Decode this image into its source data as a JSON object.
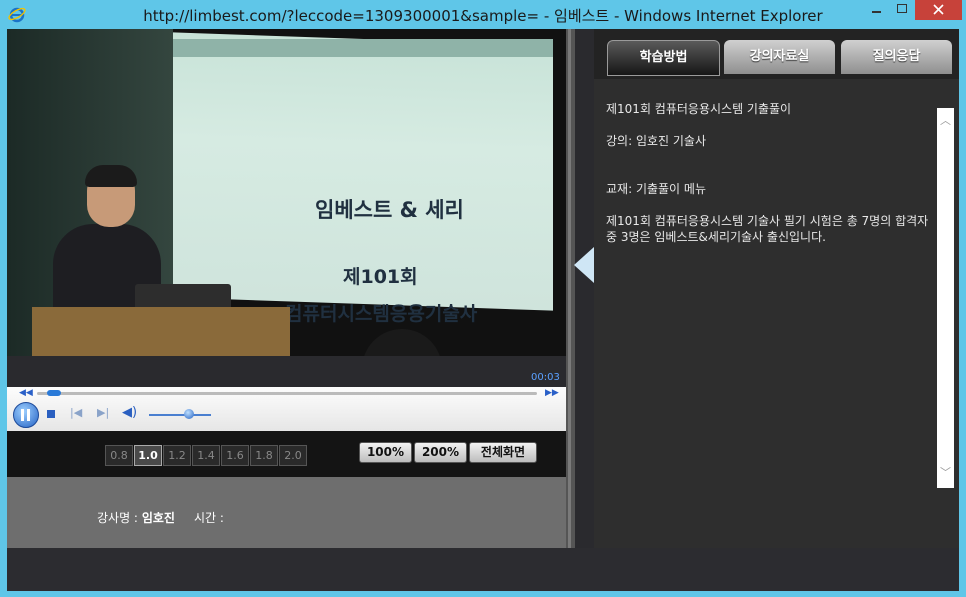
{
  "window": {
    "title": "http://limbest.com/?leccode=1309300001&sample= - 임베스트 - Windows Internet Explorer"
  },
  "colors": {
    "titlebar": "#5fc6e8",
    "close": "#c7423a",
    "accent": "#2a60c8"
  },
  "video": {
    "slide_title": "임베스트 & 세리",
    "slide_sub1": "제101회",
    "slide_sub2": "컴퓨터시스템응용기술사",
    "elapsed": "00:03"
  },
  "player": {
    "state": "playing",
    "seek_fraction": 0.02,
    "volume_fraction": 0.65
  },
  "speeds": [
    {
      "label": "0.8",
      "active": false
    },
    {
      "label": "1.0",
      "active": true
    },
    {
      "label": "1.2",
      "active": false
    },
    {
      "label": "1.4",
      "active": false
    },
    {
      "label": "1.6",
      "active": false
    },
    {
      "label": "1.8",
      "active": false
    },
    {
      "label": "2.0",
      "active": false
    }
  ],
  "size_buttons": {
    "b100": "100%",
    "b200": "200%",
    "full": "전체화면"
  },
  "info": {
    "instructor_label": "강사명 :",
    "instructor_name": "임호진",
    "time_label": "시간 :"
  },
  "tabs": [
    "학습방법",
    "강의자료실",
    "질의응답"
  ],
  "panel": {
    "line1": "제101회 컴퓨터응용시스템 기출풀이",
    "line2": "강의: 임호진 기술사",
    "line3": "교재: 기출풀이 메뉴",
    "line4": "제101회 컴퓨터응용시스템 기술사 필기 시험은 총 7명의 합격자중 3명은 임베스트&세리기술사 출신입니다."
  }
}
